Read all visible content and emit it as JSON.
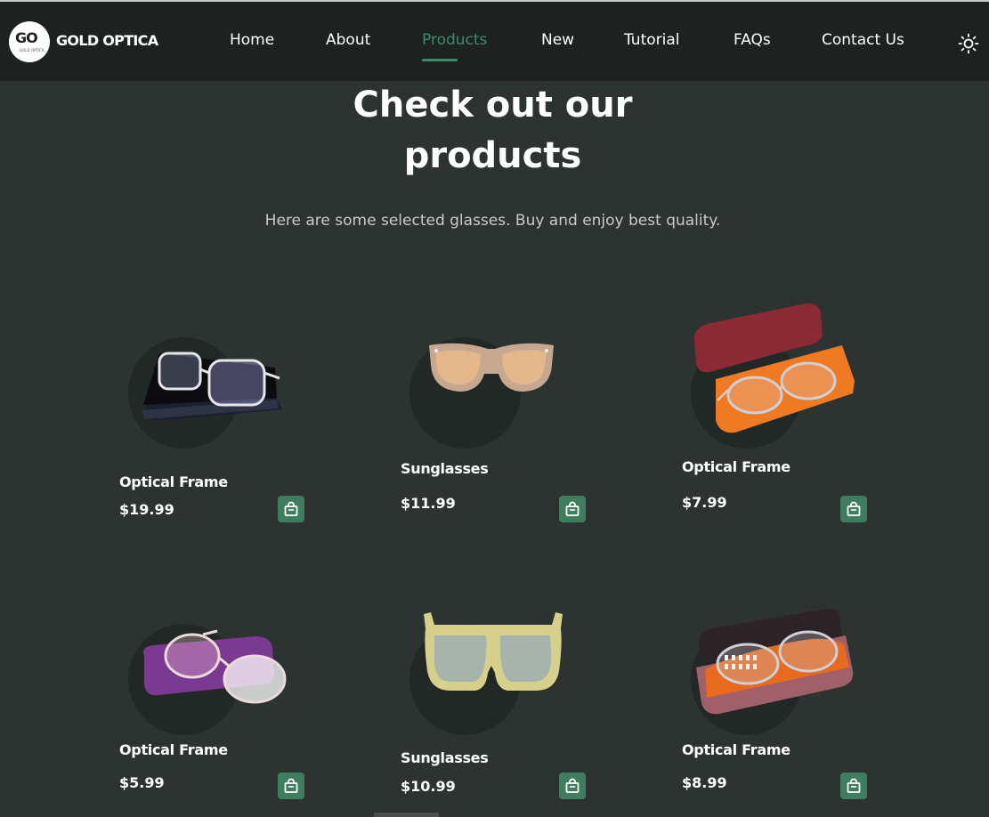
{
  "brand": {
    "name": "GOLD OPTICA",
    "logo_text": "GO",
    "logo_sub": "GOLD OPTICA"
  },
  "nav": {
    "items": [
      {
        "label": "Home"
      },
      {
        "label": "About"
      },
      {
        "label": "Products"
      },
      {
        "label": "New"
      },
      {
        "label": "Tutorial"
      },
      {
        "label": "FAQs"
      },
      {
        "label": "Contact Us"
      }
    ],
    "active": "Products",
    "theme_icon": "sun-icon"
  },
  "section": {
    "title_line1": "Check out our",
    "title_line2": "products",
    "subtitle": "Here are some selected glasses. Buy and enjoy best quality."
  },
  "products": [
    {
      "name": "Optical Frame",
      "price": "$19.99",
      "image": "clear-frame-black-case"
    },
    {
      "name": "Sunglasses",
      "price": "$11.99",
      "image": "beige-sunglasses"
    },
    {
      "name": "Optical Frame",
      "price": "$7.99",
      "image": "frame-orange-case"
    },
    {
      "name": "Optical Frame",
      "price": "$5.99",
      "image": "clear-frame-purple-case"
    },
    {
      "name": "Sunglasses",
      "price": "$10.99",
      "image": "yellow-square-sunglasses"
    },
    {
      "name": "Optical Frame",
      "price": "$8.99",
      "image": "frame-brown-case"
    }
  ],
  "colors": {
    "accent": "#3f8b6b",
    "cart_button": "#3f7d5f",
    "background": "#2c3330",
    "header": "#1d2220"
  }
}
